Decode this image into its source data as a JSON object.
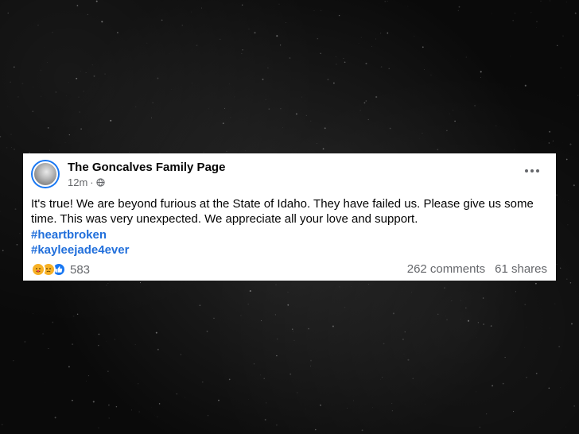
{
  "post": {
    "page_name": "The Goncalves Family Page",
    "time": "12m",
    "separator": "·",
    "body": "It's true! We are beyond furious at the State of Idaho. They have failed us. Please give us some time. This was very unexpected. We appreciate all your love and support.",
    "hashtags": [
      "#heartbroken",
      "#kayleejade4ever"
    ],
    "reactions": {
      "icons": [
        "care-reaction-icon",
        "sad-reaction-icon",
        "like-reaction-icon"
      ],
      "count": "583"
    },
    "comments": "262 comments",
    "shares": "61 shares"
  },
  "colors": {
    "accent": "#1877f2",
    "hashtag": "#216fdb",
    "secondary_text": "#65676b",
    "background": "#0b0b0b"
  }
}
